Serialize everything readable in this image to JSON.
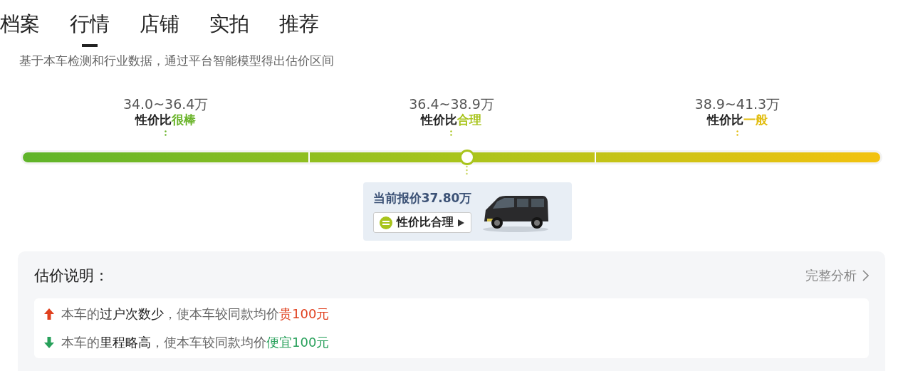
{
  "tabs": [
    {
      "label": "档案",
      "selected": false
    },
    {
      "label": "行情",
      "selected": true
    },
    {
      "label": "店铺",
      "selected": false
    },
    {
      "label": "实拍",
      "selected": false
    },
    {
      "label": "推荐",
      "selected": false
    }
  ],
  "subtitle": "基于本车检测和行业数据，通过平台智能模型得出估价区间",
  "ranges": [
    {
      "price": "34.0~36.4万",
      "prefix": "性价比",
      "rating": "很棒",
      "color": "#6ab42a"
    },
    {
      "price": "36.4~38.9万",
      "prefix": "性价比",
      "rating": "合理",
      "color": "#a8c41c"
    },
    {
      "price": "38.9~41.3万",
      "prefix": "性价比",
      "rating": "一般",
      "color": "#e2be12"
    }
  ],
  "price_bar": {
    "level": 0.518
  },
  "current": {
    "label": "当前报价37.80万",
    "verdict": "性价比合理"
  },
  "explanation": {
    "title": "估价说明：",
    "link": "完整分析",
    "items": [
      {
        "kind": "up",
        "parts": [
          "本车的",
          "过户次数少",
          "，使本车较同款均价",
          "贵100元"
        ]
      },
      {
        "kind": "down",
        "parts": [
          "本车的",
          "里程略高",
          "，使本车较同款均价",
          "便宜100元"
        ]
      }
    ]
  }
}
